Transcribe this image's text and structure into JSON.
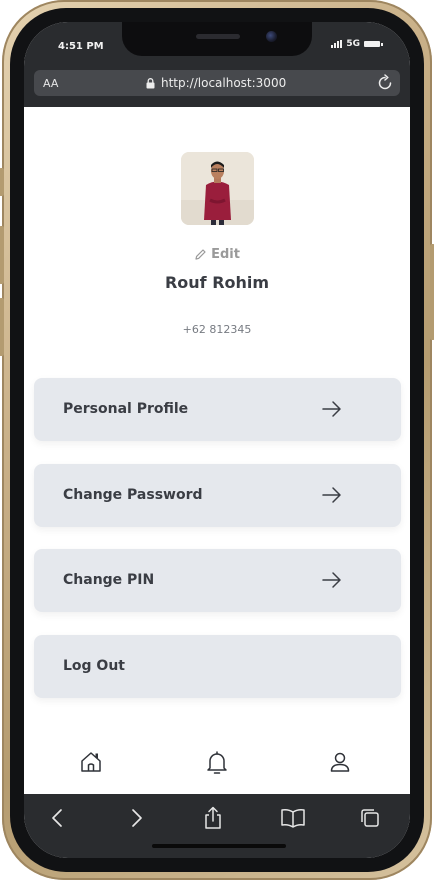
{
  "status_bar": {
    "time": "4:51 PM",
    "network": "5G",
    "signal_icon": "signal-bars-icon",
    "battery_icon": "battery-icon"
  },
  "browser": {
    "text_size_label": "AA",
    "url": "http://localhost:3000",
    "lock_icon": "lock-icon",
    "reload_icon": "reload-icon"
  },
  "profile": {
    "avatar_icon": "user-photo",
    "edit_label": "Edit",
    "name": "Rouf Rohim",
    "phone": "+62 812345"
  },
  "menu": {
    "items": [
      {
        "label": "Personal Profile",
        "has_arrow": true
      },
      {
        "label": "Change Password",
        "has_arrow": true
      },
      {
        "label": "Change PIN",
        "has_arrow": true
      },
      {
        "label": "Log Out",
        "has_arrow": false
      }
    ]
  },
  "bottom_nav": {
    "items": [
      "home-icon",
      "bell-icon",
      "user-icon"
    ]
  },
  "browser_toolbar": {
    "items": [
      "back-icon",
      "forward-icon",
      "share-icon",
      "bookmarks-icon",
      "tabs-icon"
    ]
  },
  "colors": {
    "menu_background": "#e5e8ed",
    "text_dark": "#3a3d44",
    "text_muted": "#9a9a9a",
    "browser_chrome": "#2a2c2f",
    "device_frame": "#c9b088"
  }
}
